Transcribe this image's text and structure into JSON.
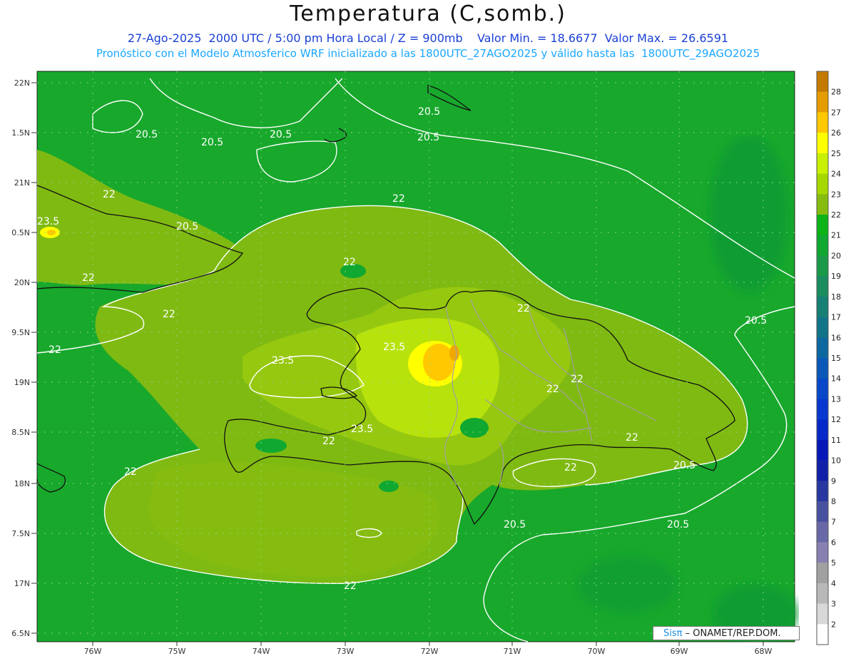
{
  "header": {
    "title": "Temperatura (C,somb.)",
    "line1": "27-Ago-2025  2000 UTC / 5:00 pm Hora Local / Z = 900mb    Valor Min. = 18.6677  Valor Max. = 26.6591",
    "line2": "Pronóstico con el Modelo Atmosferico WRF inicializado a las 1800UTC_27AGO2025 y válido hasta las  1800UTC_29AGO2025"
  },
  "map": {
    "lat_labels": [
      "22N",
      "1.5N",
      "21N",
      "0.5N",
      "20N",
      "9.5N",
      "19N",
      "8.5N",
      "18N",
      "7.5N",
      "17N",
      "6.5N"
    ],
    "lon_labels": [
      "76W",
      "75W",
      "74W",
      "73W",
      "72W",
      "71W",
      "70W",
      "69W",
      "68W"
    ],
    "contour_labels": [
      "20.5",
      "20.5",
      "20.5",
      "20.5",
      "20.5",
      "22",
      "23.5",
      "22",
      "20.5",
      "22",
      "22",
      "22",
      "22",
      "22",
      "23.5",
      "23.5",
      "23.5",
      "22",
      "22",
      "22",
      "22",
      "22",
      "22",
      "20.5",
      "20.5",
      "20.5",
      "20.5",
      "22"
    ],
    "colors": {
      "sea_green": "#18a82c",
      "deep_green": "#0f9a36",
      "olive": "#7fba12",
      "light_olive": "#96c80f",
      "yellow_green": "#b8e20c",
      "orange": "#f0a800",
      "coast": "#111111",
      "province_border": "#a0a0a0",
      "contour": "#ffffff"
    }
  },
  "colorbar": {
    "labels": [
      "28",
      "27",
      "26",
      "25",
      "24",
      "23",
      "22",
      "21",
      "20",
      "19",
      "18",
      "17",
      "16",
      "15",
      "14",
      "13",
      "12",
      "11",
      "10",
      "9",
      "8",
      "7",
      "6",
      "5",
      "4",
      "3",
      "2"
    ],
    "colors": [
      "#c47a00",
      "#e59c00",
      "#ffc800",
      "#ffff00",
      "#c8f000",
      "#a6d800",
      "#86bc10",
      "#0cb418",
      "#10a830",
      "#1a9a48",
      "#1a8c5e",
      "#168074",
      "#127488",
      "#0e68a0",
      "#0a58b8",
      "#0848c8",
      "#0838d0",
      "#0628c8",
      "#0618b8",
      "#1020a8",
      "#2838a0",
      "#4850a0",
      "#6868a8",
      "#8880b0",
      "#a0a0a0",
      "#b8b8b8",
      "#d8d8d8",
      "#ffffff"
    ]
  },
  "credit": {
    "brand": "Sisπ",
    "org": " – ONAMET/REP.DOM."
  }
}
